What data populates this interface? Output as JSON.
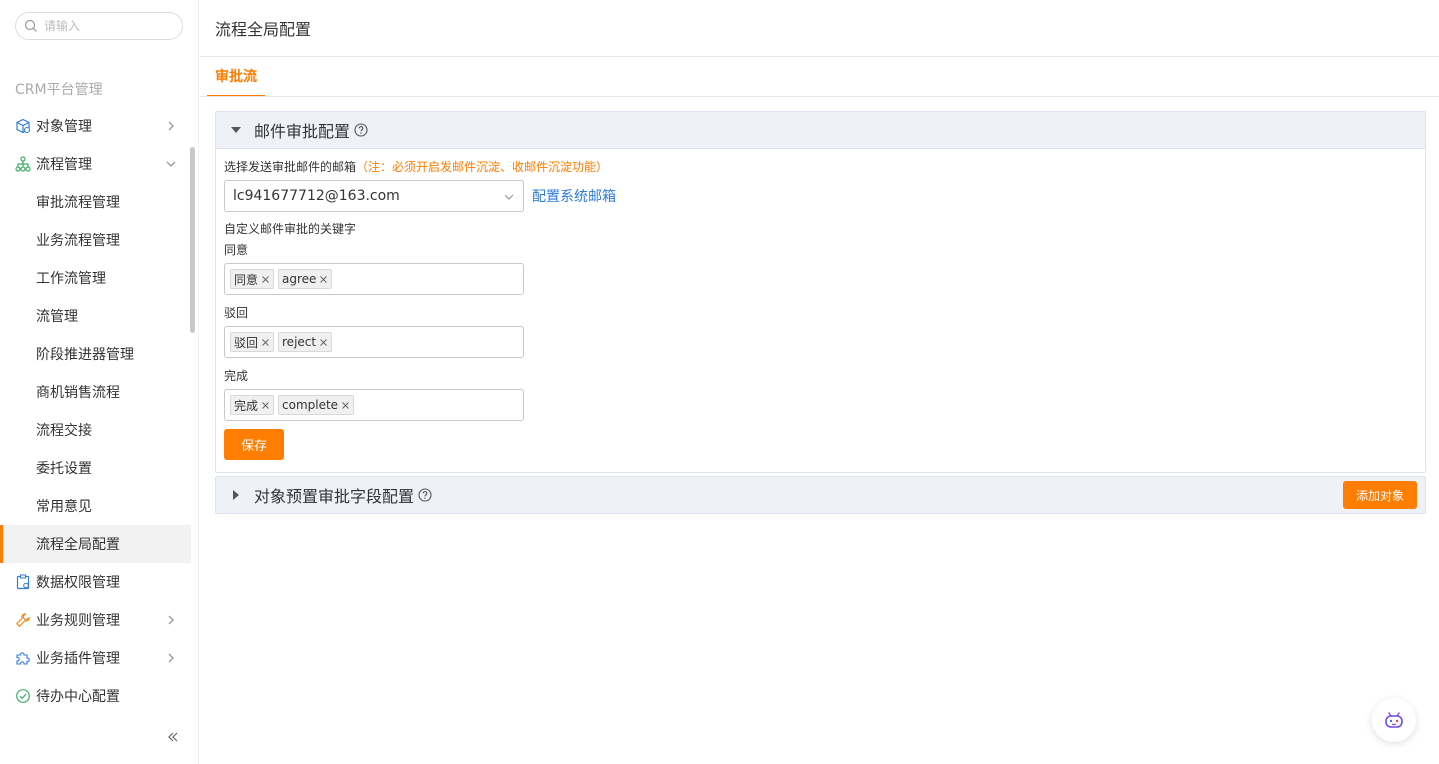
{
  "sidebar": {
    "search_placeholder": "请输入",
    "section_title": "CRM平台管理",
    "items": {
      "object": "对象管理",
      "process": "流程管理",
      "data_permission": "数据权限管理",
      "business_rules": "业务规则管理",
      "business_plugins": "业务插件管理",
      "todo_center": "待办中心配置"
    },
    "sub_items": [
      "审批流程管理",
      "业务流程管理",
      "工作流管理",
      "流管理",
      "阶段推进器管理",
      "商机销售流程",
      "流程交接",
      "委托设置",
      "常用意见",
      "流程全局配置"
    ]
  },
  "header": {
    "title": "流程全局配置"
  },
  "tabs": [
    {
      "label": "审批流"
    }
  ],
  "email_panel": {
    "title": "邮件审批配置",
    "mailbox_label": "选择发送审批邮件的邮箱",
    "mailbox_note": "（注：必须开启发邮件沉淀、收邮件沉淀功能）",
    "mailbox_value": "lc941677712@163.com",
    "config_link": "配置系统邮箱",
    "keywords_label": "自定义邮件审批的关键字",
    "agree_label": "同意",
    "agree_tags": [
      "同意",
      "agree"
    ],
    "reject_label": "驳回",
    "reject_tags": [
      "驳回",
      "reject"
    ],
    "complete_label": "完成",
    "complete_tags": [
      "完成",
      "complete"
    ],
    "save_label": "保存"
  },
  "object_panel": {
    "title": "对象预置审批字段配置",
    "add_label": "添加对象"
  },
  "colors": {
    "accent": "#ff7d00",
    "link": "#2f7bd9",
    "panel_head": "#eef1f8"
  }
}
